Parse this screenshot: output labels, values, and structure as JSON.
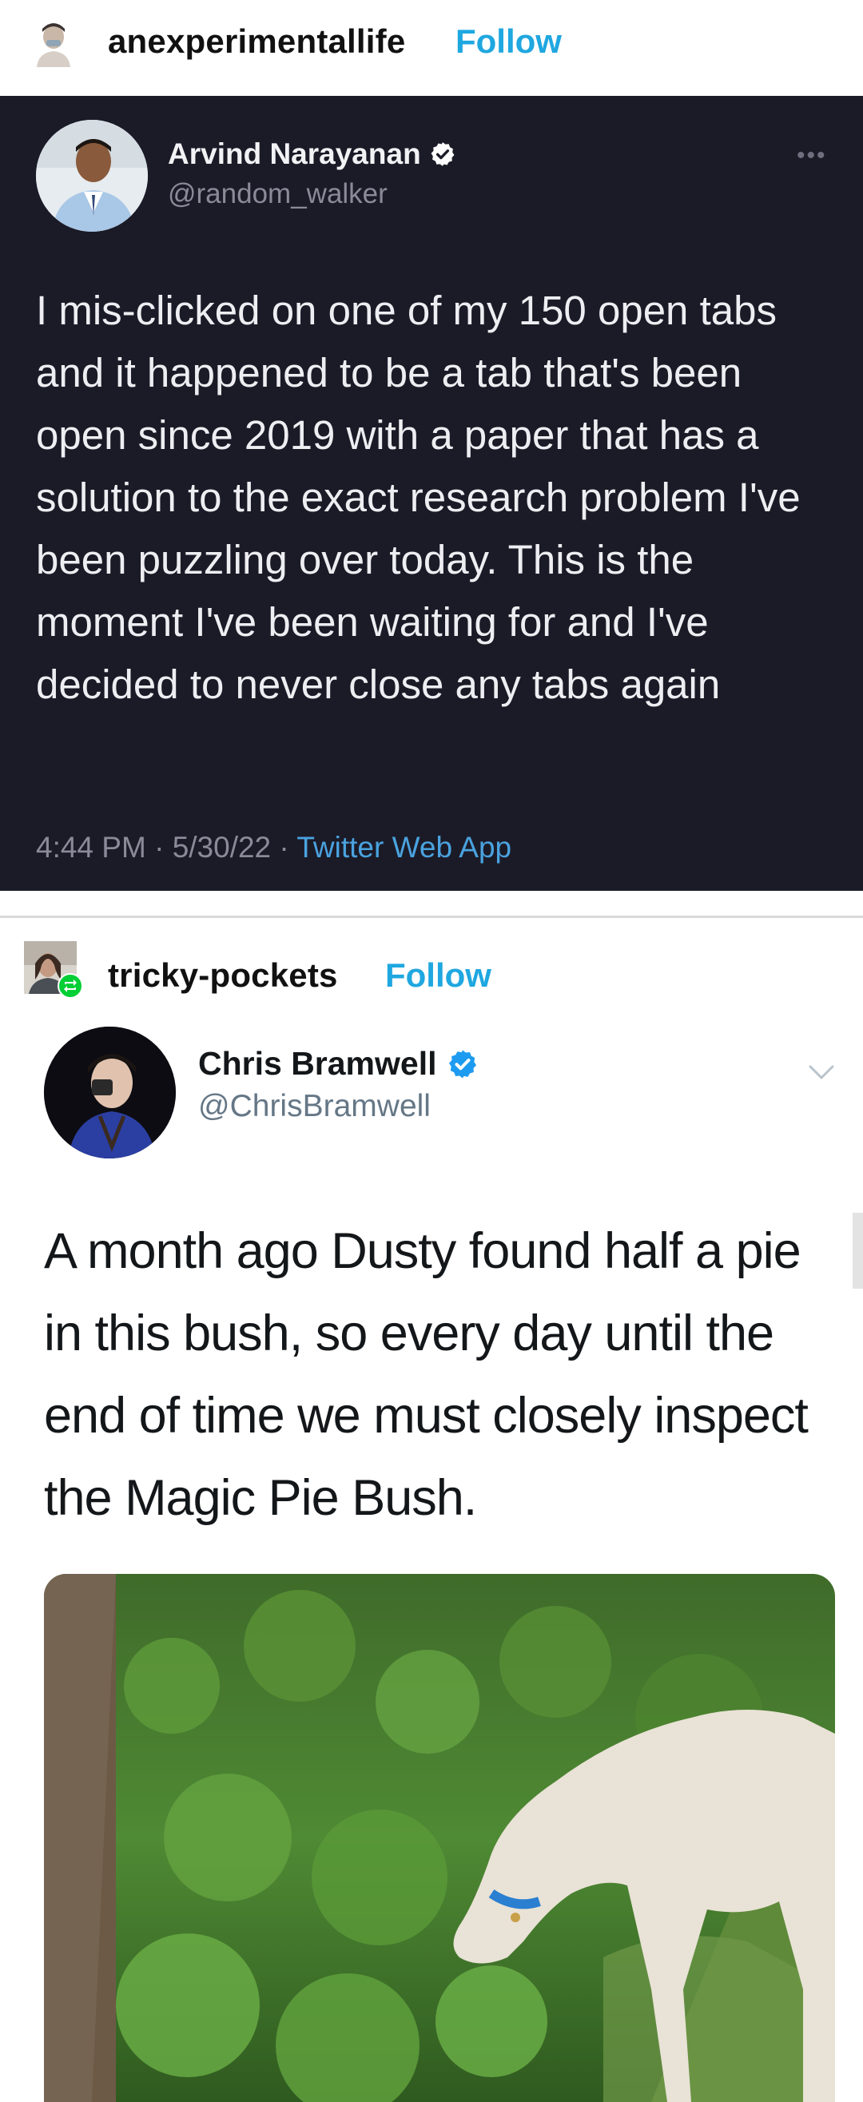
{
  "posts": [
    {
      "blog": {
        "name": "anexperimentallife",
        "follow_label": "Follow"
      },
      "tweet": {
        "author_name": "Arvind Narayanan",
        "handle": "@random_walker",
        "more_label": "•••",
        "text": "I mis-clicked on one of my 150 open tabs and it happened to be a tab that's been open since 2019 with a paper that has a solution to the exact research problem I've been puzzling over today. This is the moment I've been waiting for and I've decided to never close any tabs again",
        "time": "4:44 PM",
        "date": "5/30/22",
        "separator": "·",
        "source": "Twitter Web App"
      }
    },
    {
      "blog": {
        "name": "tricky-pockets",
        "follow_label": "Follow"
      },
      "tweet": {
        "author_name": "Chris Bramwell",
        "handle": "@ChrisBramwell",
        "text": "A month ago Dusty found half a pie in this bush, so every day until the end of time we must closely inspect the Magic Pie Bush."
      }
    }
  ],
  "colors": {
    "follow": "#1fa7e0",
    "dark_tweet_bg": "#1b1b28",
    "verified": "#1d9bf0",
    "link": "#4aa3df"
  },
  "icons": [
    "verified-badge-icon",
    "more-options-icon",
    "chevron-down-icon",
    "reblog-icon"
  ]
}
